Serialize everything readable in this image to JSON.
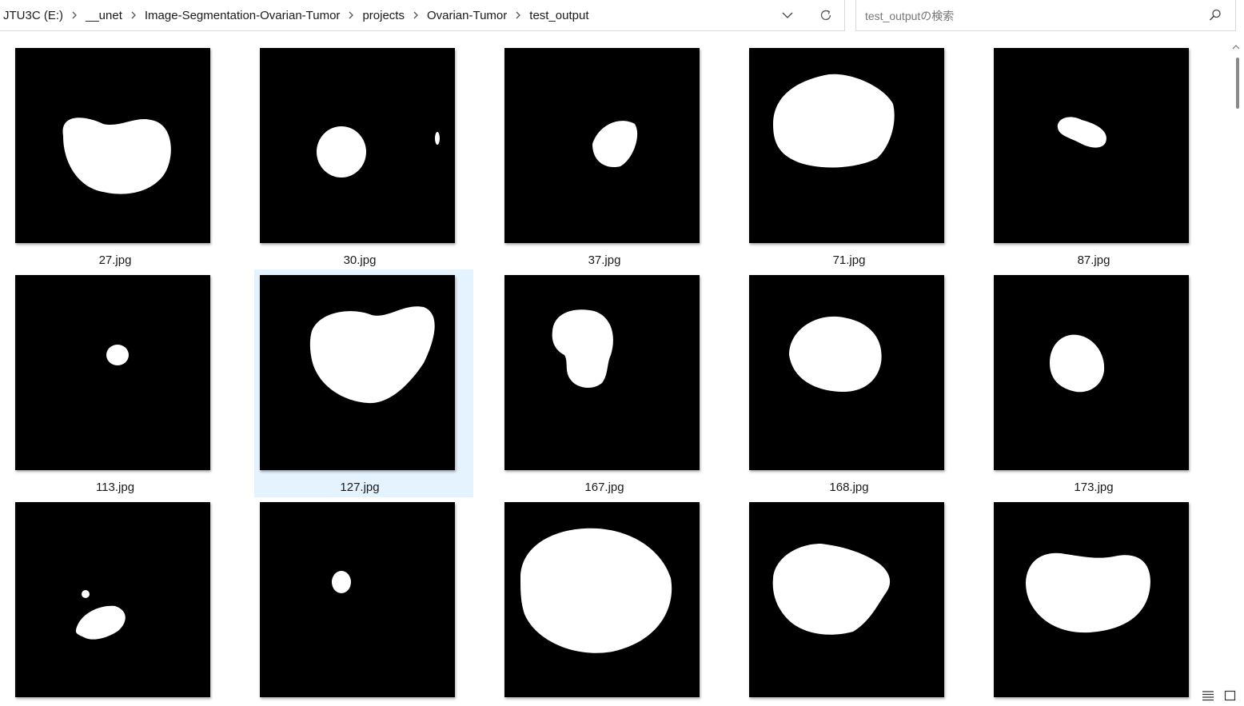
{
  "breadcrumb": [
    "JTU3C (E:)",
    "__unet",
    "Image-Segmentation-Ovarian-Tumor",
    "projects",
    "Ovarian-Tumor",
    "test_output"
  ],
  "search": {
    "placeholder": "test_outputの検索"
  },
  "files": [
    {
      "name": "27.jpg",
      "shape": "kidney-large"
    },
    {
      "name": "30.jpg",
      "shape": "small-oval"
    },
    {
      "name": "37.jpg",
      "shape": "small-tilted"
    },
    {
      "name": "71.jpg",
      "shape": "large-rounded"
    },
    {
      "name": "87.jpg",
      "shape": "tiny-blob"
    },
    {
      "name": "113.jpg",
      "shape": "tiny-dot"
    },
    {
      "name": "127.jpg",
      "shape": "large-triangle",
      "selected": true
    },
    {
      "name": "167.jpg",
      "shape": "stacked"
    },
    {
      "name": "168.jpg",
      "shape": "round-medium"
    },
    {
      "name": "173.jpg",
      "shape": "small-round"
    },
    {
      "name": "",
      "shape": "small-low"
    },
    {
      "name": "",
      "shape": "tiny-dot-2"
    },
    {
      "name": "",
      "shape": "big-oval"
    },
    {
      "name": "",
      "shape": "irregular-large"
    },
    {
      "name": "",
      "shape": "kidney-wide"
    }
  ],
  "colors": {
    "selection": "#e5f3ff",
    "thumbnail_bg": "#000000",
    "mask": "#ffffff"
  }
}
